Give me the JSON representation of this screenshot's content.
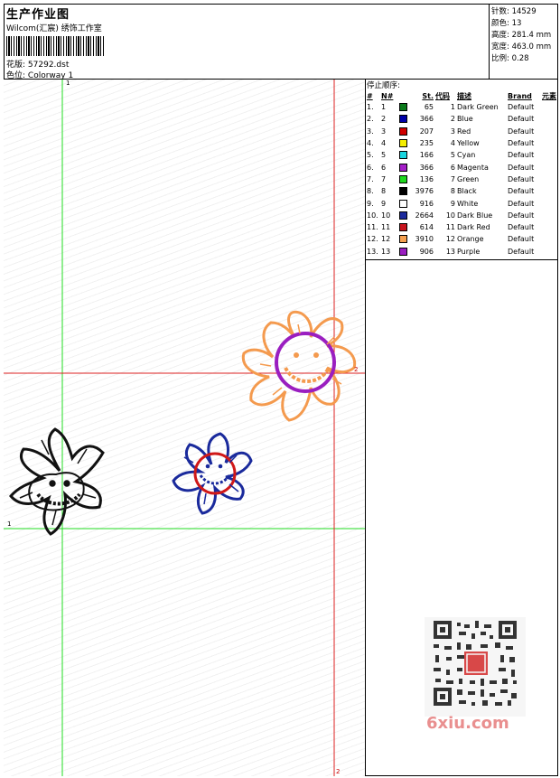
{
  "header": {
    "title": "生产作业图",
    "company": "Wilcom(汇宸) 绣饰工作室",
    "design_file_label": "花版:",
    "design_file": "57292.dst",
    "colorway_label": "色位:",
    "colorway": "Colorway 1"
  },
  "stats": {
    "stitches_label": "针数:",
    "stitches": "14529",
    "colors_label": "颜色:",
    "colors": "13",
    "height_label": "高度:",
    "height": "281.4 mm",
    "width_label": "宽度:",
    "width": "463.0 mm",
    "scale_label": "比例:",
    "scale": "0.28"
  },
  "legend": {
    "title": "停止顺序:",
    "headers": [
      "#",
      "N#",
      "St.",
      "代码",
      "描述",
      "Brand",
      "元素"
    ],
    "rows": [
      {
        "idx": "1.",
        "n": "1",
        "st": "65",
        "code": "1",
        "desc": "Dark Green",
        "brand": "Default",
        "color": "#0b7a1b"
      },
      {
        "idx": "2.",
        "n": "2",
        "st": "366",
        "code": "2",
        "desc": "Blue",
        "brand": "Default",
        "color": "#0000a8"
      },
      {
        "idx": "3.",
        "n": "3",
        "st": "207",
        "code": "3",
        "desc": "Red",
        "brand": "Default",
        "color": "#d00000"
      },
      {
        "idx": "4.",
        "n": "4",
        "st": "235",
        "code": "4",
        "desc": "Yellow",
        "brand": "Default",
        "color": "#f5ee00"
      },
      {
        "idx": "5.",
        "n": "5",
        "st": "166",
        "code": "5",
        "desc": "Cyan",
        "brand": "Default",
        "color": "#19d5e0"
      },
      {
        "idx": "6.",
        "n": "6",
        "st": "366",
        "code": "6",
        "desc": "Magenta",
        "brand": "Default",
        "color": "#a41ec8"
      },
      {
        "idx": "7.",
        "n": "7",
        "st": "136",
        "code": "7",
        "desc": "Green",
        "brand": "Default",
        "color": "#1ed81e"
      },
      {
        "idx": "8.",
        "n": "8",
        "st": "3976",
        "code": "8",
        "desc": "Black",
        "brand": "Default",
        "color": "#000000"
      },
      {
        "idx": "9.",
        "n": "9",
        "st": "916",
        "code": "9",
        "desc": "White",
        "brand": "Default",
        "color": "#ffffff"
      },
      {
        "idx": "10.",
        "n": "10",
        "st": "2664",
        "code": "10",
        "desc": "Dark Blue",
        "brand": "Default",
        "color": "#1b2a9c"
      },
      {
        "idx": "11.",
        "n": "11",
        "st": "614",
        "code": "11",
        "desc": "Dark Red",
        "brand": "Default",
        "color": "#c8141e"
      },
      {
        "idx": "12.",
        "n": "12",
        "st": "3910",
        "code": "12",
        "desc": "Orange",
        "brand": "Default",
        "color": "#f5a050"
      },
      {
        "idx": "13.",
        "n": "13",
        "st": "906",
        "code": "13",
        "desc": "Purple",
        "brand": "Default",
        "color": "#9a1ec0"
      }
    ]
  },
  "guides": {
    "v1": "1",
    "h1": "1",
    "v2": "2",
    "h2": "2"
  },
  "watermark": {
    "site": "6xiu.com"
  },
  "colors": {
    "guide_green": "#22dd22",
    "guide_red": "#dd2222"
  }
}
